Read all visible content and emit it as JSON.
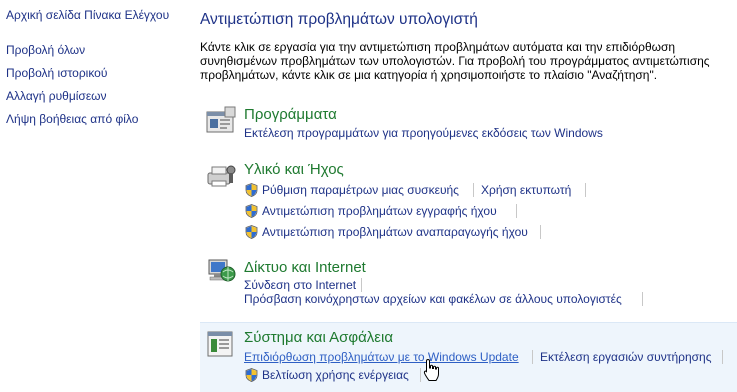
{
  "sidebar": {
    "items": [
      {
        "label": "Αρχική σελίδα Πίνακα Ελέγχου"
      },
      {
        "label": "Προβολή όλων"
      },
      {
        "label": "Προβολή ιστορικού"
      },
      {
        "label": "Αλλαγή ρυθμίσεων"
      },
      {
        "label": "Λήψη βοήθειας από φίλο"
      }
    ]
  },
  "main": {
    "title": "Αντιμετώπιση προβλημάτων υπολογιστή",
    "intro": "Κάντε κλικ σε εργασία για την αντιμετώπιση προβλημάτων αυτόματα και την επιδιόρθωση συνηθισμένων προβλημάτων των υπολογιστών. Για προβολή του προγράμματος αντιμετώπισης προβλημάτων, κάντε κλικ σε μια κατηγορία ή χρησιμοποιήστε το πλαίσιο \"Αναζήτηση\"."
  },
  "categories": [
    {
      "title": "Προγράμματα",
      "icon": "programs-icon",
      "links": [
        {
          "label": "Εκτέλεση προγραμμάτων για προηγούμενες εκδόσεις των Windows",
          "shield": false
        }
      ]
    },
    {
      "title": "Υλικό και Ήχος",
      "icon": "hardware-sound-icon",
      "links": [
        {
          "label": "Ρύθμιση παραμέτρων μιας συσκευής",
          "shield": true
        },
        {
          "label": "Χρήση εκτυπωτή",
          "shield": false
        },
        {
          "label": "Αντιμετώπιση προβλημάτων εγγραφής ήχου",
          "shield": true
        },
        {
          "label": "Αντιμετώπιση προβλημάτων αναπαραγωγής ήχου",
          "shield": true
        }
      ]
    },
    {
      "title": "Δίκτυο και Internet",
      "icon": "network-internet-icon",
      "links": [
        {
          "label": "Σύνδεση στο Internet",
          "shield": false
        },
        {
          "label": "Πρόσβαση κοινόχρηστων αρχείων και φακέλων σε άλλους υπολογιστές",
          "shield": false
        }
      ]
    },
    {
      "title": "Σύστημα και Ασφάλεια",
      "icon": "system-security-icon",
      "links": [
        {
          "label": "Επιδιόρθωση προβλημάτων με το Windows Update",
          "shield": false
        },
        {
          "label": "Εκτέλεση εργασιών συντήρησης",
          "shield": false
        },
        {
          "label": "Βελτίωση χρήσης ενέργειας",
          "shield": true
        }
      ]
    }
  ],
  "colors": {
    "link": "#1e3287",
    "category_title": "#1f7a30",
    "highlight_bg": "#eef5fc"
  }
}
